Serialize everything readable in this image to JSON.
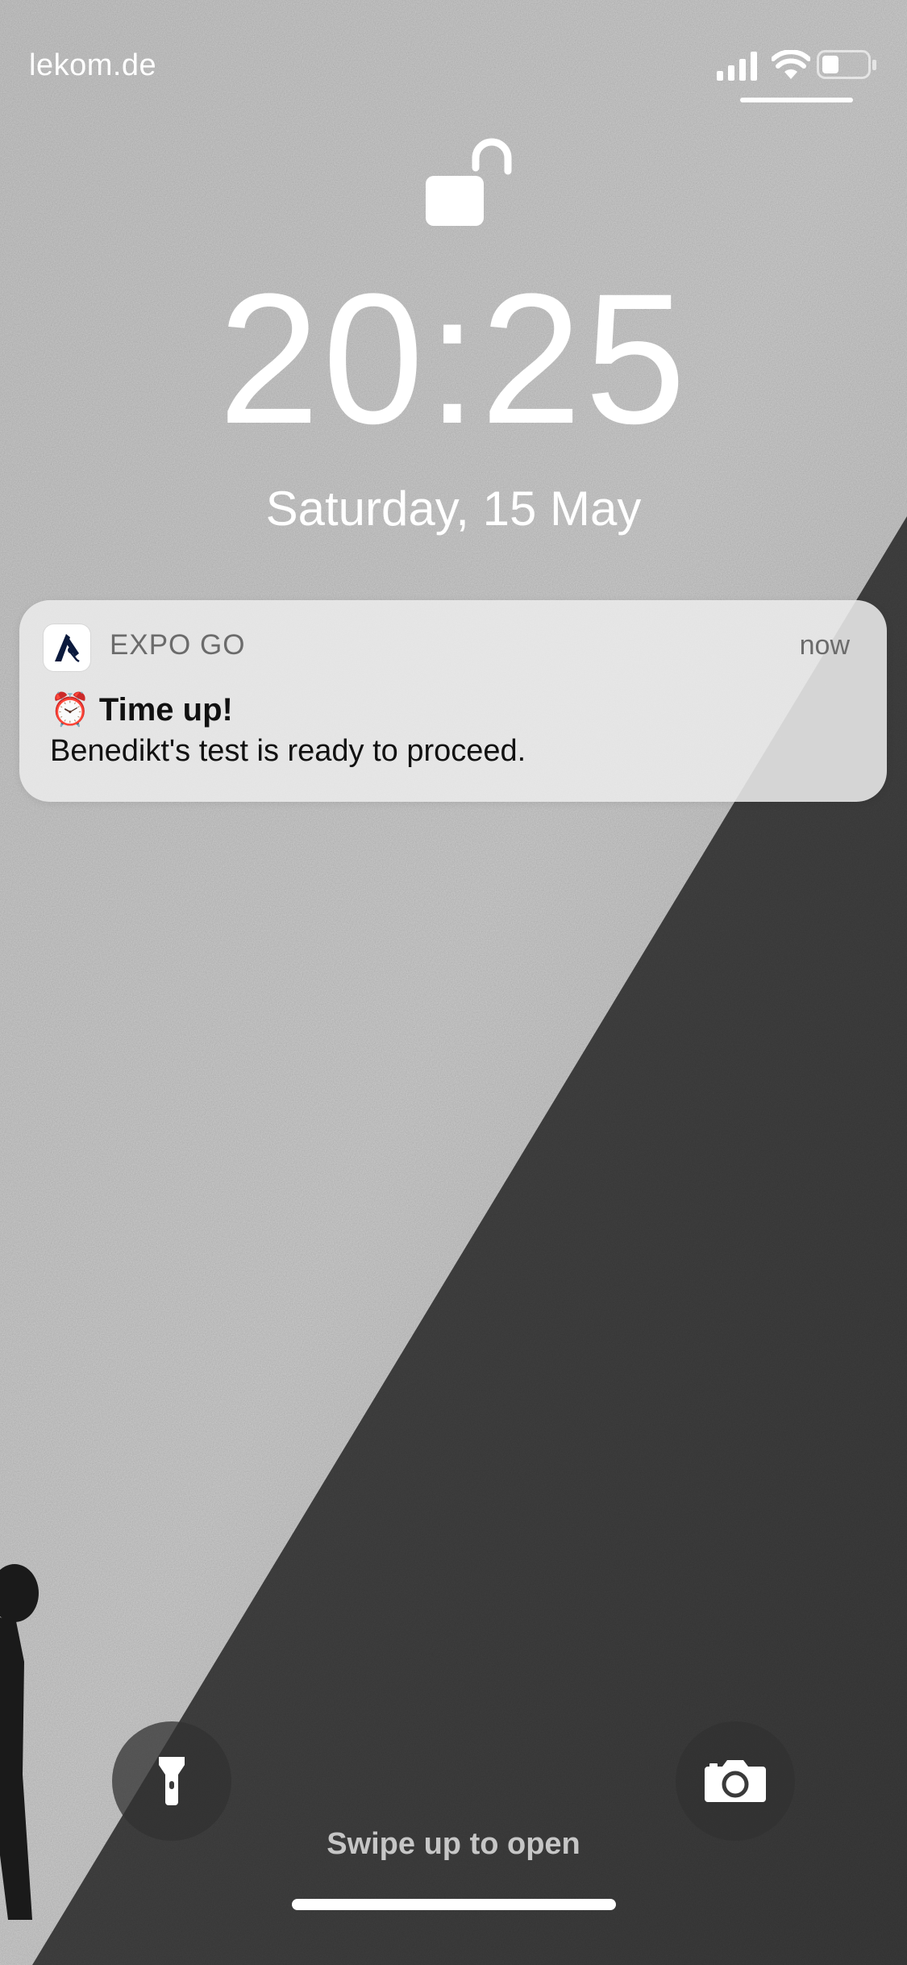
{
  "status_bar": {
    "carrier": "lekom.de",
    "icons": [
      "cellular-signal-icon",
      "wifi-icon",
      "battery-icon"
    ]
  },
  "lock_screen": {
    "lock_icon": "unlocked-padlock-icon",
    "time": "20:25",
    "date": "Saturday, 15 May"
  },
  "notification": {
    "app_name": "EXPO GO",
    "timestamp": "now",
    "title": "⏰ Time up!",
    "body": "Benedikt's test is ready to proceed."
  },
  "bottom": {
    "flashlight_icon": "flashlight-icon",
    "camera_icon": "camera-icon",
    "hint": "Swipe up to open"
  },
  "colors": {
    "notification_bg": "#ebebeb",
    "text_primary": "#111111",
    "text_secondary": "#6b6b6b"
  }
}
